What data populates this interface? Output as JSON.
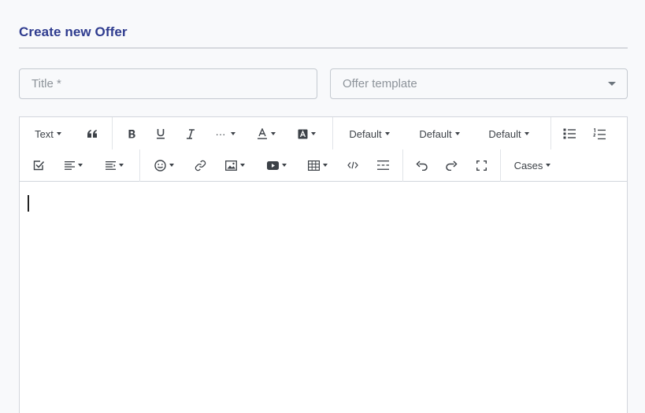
{
  "page": {
    "title": "Create new Offer"
  },
  "form": {
    "title_placeholder": "Title *",
    "template_placeholder": "Offer template"
  },
  "toolbar": {
    "row1": {
      "text_label": "Text",
      "default_1": "Default",
      "default_2": "Default",
      "default_3": "Default",
      "more_label": "···"
    },
    "row2": {
      "cases_label": "Cases"
    },
    "icons": [
      "quote-icon",
      "bold-icon",
      "underline-icon",
      "italic-icon",
      "more-icon",
      "font-color-icon",
      "background-color-icon",
      "bullet-list-icon",
      "numbered-list-icon",
      "checklist-icon",
      "align-icon",
      "indent-icon",
      "emoji-icon",
      "link-icon",
      "image-icon",
      "video-icon",
      "table-icon",
      "code-icon",
      "horizontal-rule-icon",
      "undo-icon",
      "redo-icon",
      "fullscreen-icon"
    ]
  },
  "editor": {
    "content": ""
  }
}
